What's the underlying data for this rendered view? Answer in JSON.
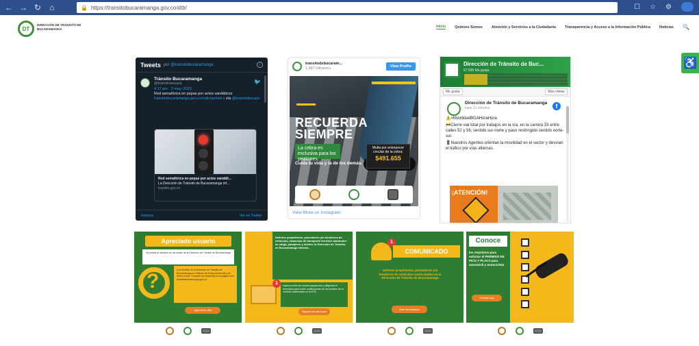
{
  "browser": {
    "url": "https://transitobucaramanga.gov.co/dtb/"
  },
  "site": {
    "logo_text": "DIRECCIÓN DE TRÁNSITO DE BUCARAMANGA",
    "nav": [
      {
        "label": "Inicio"
      },
      {
        "label": "Quiénes Somos"
      },
      {
        "label": "Atención y Servicios a la Ciudadanía"
      },
      {
        "label": "Transparencia y Acceso a la Información Pública"
      },
      {
        "label": "Noticias"
      }
    ]
  },
  "twitter": {
    "header": "Tweets",
    "by_prefix": "por",
    "by_handle": "@transitobucaramanga",
    "account_name": "Tránsito Bucaramanga",
    "handle": "@transitobucara",
    "date": "4:17 pm · 3 may. 2023",
    "text": "Red semafórica en pepas por actos vandálicos",
    "link": "transitobucaramanga.gov.co/noticias/red-s",
    "via": "vía",
    "via_handle": "@transitobucara",
    "card_title": "Red semafórica en pepas por actos vandáli...",
    "card_desc": "La Dirección de Tránsito de Bucaramanga inf...",
    "card_domain": "transito.gov.co",
    "embed": "Insertar",
    "view_on": "Ver en Twitter"
  },
  "instagram": {
    "account": "transitodebucaram...",
    "followers": "1.587 followers",
    "view_profile": "View Profile",
    "post_title_1": "RECUERDA",
    "post_title_2": "SIEMPRE",
    "post_green": "La cebra es exclusiva para los peatones.",
    "post_sub": "Cuida tu vida y la de los demás.",
    "fine_text": "Multa por entorpecer circular de la cebra:",
    "fine_amount": "$491.655",
    "view_more": "View More on Instagram"
  },
  "facebook": {
    "cover_title": "Dirección de Tránsito de Buc...",
    "cover_sub": "67.590 Me gusta",
    "like_button": "Me gusta",
    "share_button": "Más visitas",
    "page_name": "Dirección de Tránsito de Bucaramanga",
    "time": "hace 11 minutos",
    "post_line1": "⚠️#MovilidadBGAHoraHora",
    "post_line2": "🚧Cierre vial total por trabajos en la vía, en la carrera 33 entre calles 52 y 56, sentido sur-norte y paso restringido sentido norte-sur.",
    "post_line3": "🚦Nuestros Agentes orientan la movilidad en el sector y desvían el tráfico por vías alternas.",
    "image_label": "¡ATENCIÓN!"
  },
  "banners": {
    "b1_title": "Apreciado usuario",
    "b1_box": "Se presta la atención en las sedes de la Dirección de Tránsito de Bucaramanga",
    "b1_body": "Los trámites de la Dirección de Tránsito de Bucaramanga se realizan de forma presencial y de forma virtual. Consulte los requisitos en la página web transitobucaramanga.gov.co",
    "b1_btn": "Agenda tu cita",
    "b2_text": "Señores propietarios, poseedores y/o tenedores de vehículos, empresas de transporte terrestre automotor de carga, pasajeros y mixtos: la Dirección de Tránsito de Bucaramanga informa...",
    "b2_body": "Ingresa al link de nuestra página web y diligencia el formulario para recibir notificaciones de los trámites de tu vehículo matriculado en la DTB.",
    "b2_btn": "Registra tus datos aquí",
    "b3_badge": "1",
    "b2_badge": "1",
    "b3_title": "COMUNICADO",
    "b3_text": "Señores propietarios, poseedores y/o tenedores de vehículos matriculados en la Dirección de Tránsito de Bucaramanga",
    "b3_btn": "Más información",
    "b4_title": "Conoce",
    "b4_text": "los requisitos para solicitar el PERMISO DE PICO Y PLACA para automóvil y motocicleta",
    "b4_btn": "Consulta aquí"
  }
}
